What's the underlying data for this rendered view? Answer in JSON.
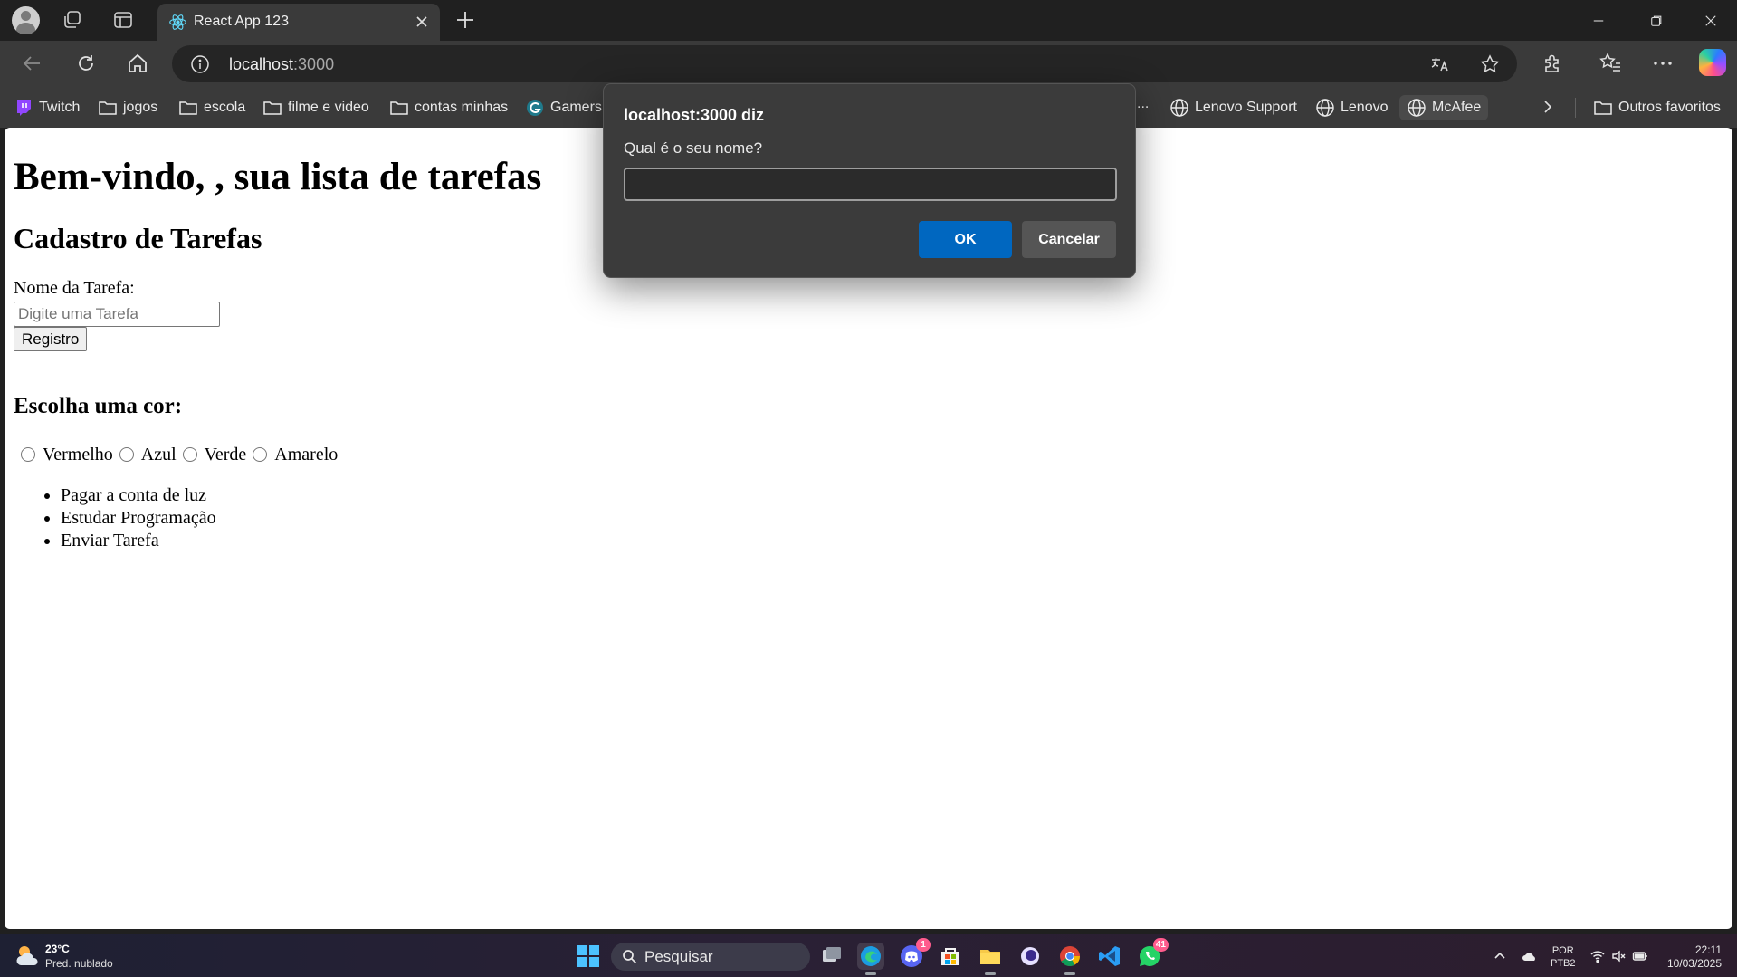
{
  "browser": {
    "tab": {
      "title": "React App 123"
    },
    "url": {
      "host": "localhost",
      "port": ":3000"
    },
    "bookmarks": [
      {
        "label": "Twitch",
        "icon": "twitch-icon"
      },
      {
        "label": "jogos",
        "icon": "folder-icon"
      },
      {
        "label": "escola",
        "icon": "folder-icon"
      },
      {
        "label": "filme e video",
        "icon": "folder-icon"
      },
      {
        "label": "contas minhas",
        "icon": "folder-icon"
      },
      {
        "label": "Gamers",
        "icon": "gamers-icon"
      },
      {
        "label": "...",
        "icon": ""
      },
      {
        "label": "Lenovo Support",
        "icon": "globe-icon"
      },
      {
        "label": "Lenovo",
        "icon": "globe-icon"
      },
      {
        "label": "McAfee",
        "icon": "globe-icon"
      },
      {
        "label": "Outros favoritos",
        "icon": "folder-icon"
      }
    ]
  },
  "page": {
    "heading": "Bem-vindo, , sua lista de tarefas",
    "subheading": "Cadastro de Tarefas",
    "task_label": "Nome da Tarefa:",
    "task_placeholder": "Digite uma Tarefa",
    "register_button": "Registro",
    "color_heading": "Escolha uma cor:",
    "colors": [
      "Vermelho",
      "Azul",
      "Verde",
      "Amarelo"
    ],
    "tasks": [
      "Pagar a conta de luz",
      "Estudar Programação",
      "Enviar Tarefa"
    ]
  },
  "dialog": {
    "title": "localhost:3000 diz",
    "message": "Qual é o seu nome?",
    "input_value": "",
    "ok_label": "OK",
    "cancel_label": "Cancelar",
    "ok_color": "#0067c0"
  },
  "taskbar": {
    "weather_temp": "23°C",
    "weather_desc": "Pred. nublado",
    "search_label": "Pesquisar",
    "discord_badge": "1",
    "whatsapp_badge": "41",
    "lang_line1": "POR",
    "lang_line2": "PTB2",
    "time": "22:11",
    "date": "10/03/2025"
  }
}
